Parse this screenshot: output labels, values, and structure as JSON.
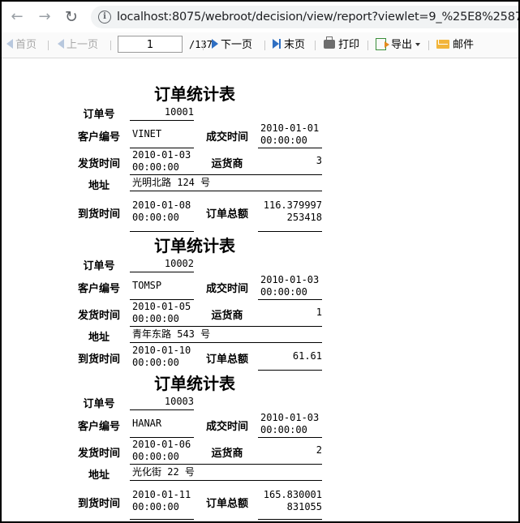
{
  "browser": {
    "url": "localhost:8075/webroot/decision/view/report?viewlet=9_%25E8%2587%25"
  },
  "toolbar": {
    "first": "首页",
    "prev": "上一页",
    "page_value": "1",
    "page_total": "/137",
    "next": "下一页",
    "last": "末页",
    "print": "打印",
    "export": "导出",
    "email": "邮件"
  },
  "report": {
    "title": "订单统计表",
    "labels": {
      "order_id": "订单号",
      "customer_id": "客户编号",
      "deal_time": "成交时间",
      "ship_time": "发货时间",
      "shipper": "运货商",
      "address": "地址",
      "arrival_time": "到货时间",
      "total": "订单总额"
    },
    "orders": [
      {
        "order_id": "10001",
        "customer_id": "VINET",
        "deal_date": "2010-01-01",
        "deal_clock": "00:00:00",
        "ship_date": "2010-01-03",
        "ship_clock": "00:00:00",
        "shipper": "3",
        "address": "光明北路 124 号",
        "arrival_date": "2010-01-08",
        "arrival_clock": "00:00:00",
        "total_line1": "116.379997",
        "total_line2": "253418"
      },
      {
        "order_id": "10002",
        "customer_id": "TOMSP",
        "deal_date": "2010-01-03",
        "deal_clock": "00:00:00",
        "ship_date": "2010-01-05",
        "ship_clock": "00:00:00",
        "shipper": "1",
        "address": "青年东路 543 号",
        "arrival_date": "2010-01-10",
        "arrival_clock": "00:00:00",
        "total_line1": "61.61",
        "total_line2": ""
      },
      {
        "order_id": "10003",
        "customer_id": "HANAR",
        "deal_date": "2010-01-03",
        "deal_clock": "00:00:00",
        "ship_date": "2010-01-06",
        "ship_clock": "00:00:00",
        "shipper": "2",
        "address": "光化街 22 号",
        "arrival_date": "2010-01-11",
        "arrival_clock": "00:00:00",
        "total_line1": "165.830001",
        "total_line2": "831055"
      }
    ]
  }
}
